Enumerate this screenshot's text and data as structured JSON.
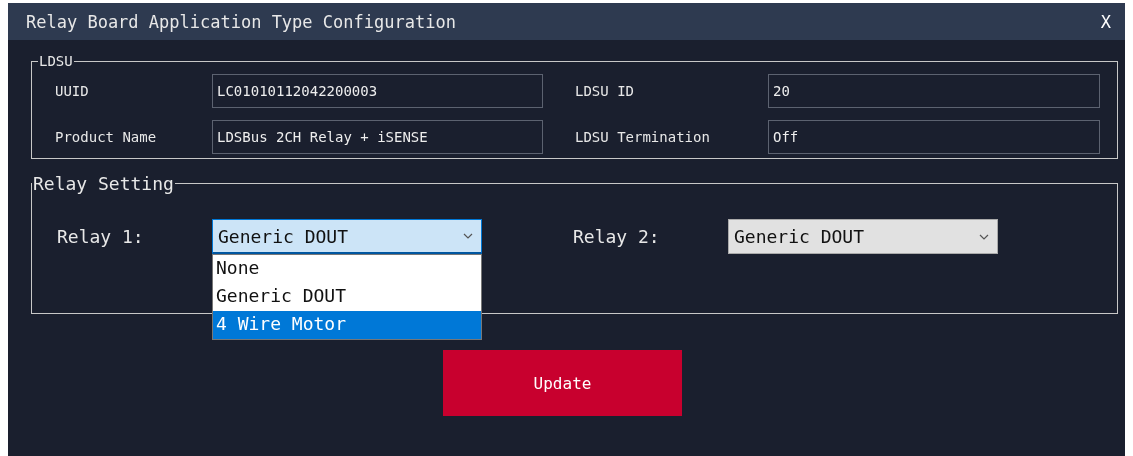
{
  "window": {
    "title": "Relay Board Application Type Configuration",
    "close": "X"
  },
  "ldsu": {
    "legend": "LDSU",
    "fields": [
      {
        "label": "UUID",
        "value": "LC01010112042200003"
      },
      {
        "label": "LDSU ID",
        "value": "20"
      },
      {
        "label": "Product Name",
        "value": "LDSBus 2CH Relay + iSENSE"
      },
      {
        "label": "LDSU Termination",
        "value": "Off"
      }
    ]
  },
  "relay_setting": {
    "legend": "Relay Setting",
    "relays": [
      {
        "label": "Relay 1:",
        "value": "Generic DOUT",
        "expanded": true,
        "options": [
          {
            "label": "None",
            "highlighted": false
          },
          {
            "label": "Generic DOUT",
            "highlighted": false
          },
          {
            "label": "4 Wire Motor",
            "highlighted": true
          }
        ]
      },
      {
        "label": "Relay 2:",
        "value": "Generic DOUT",
        "expanded": false
      }
    ]
  },
  "update_button": "Update"
}
